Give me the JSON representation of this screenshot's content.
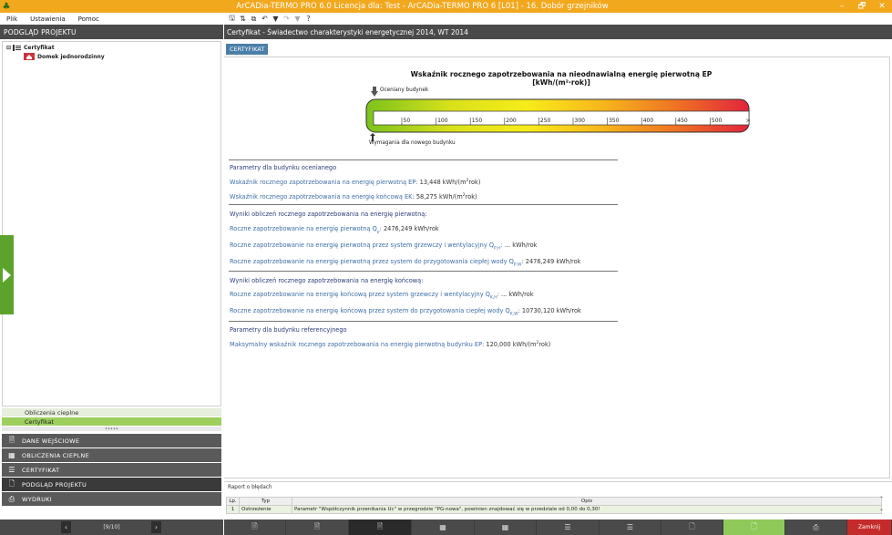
{
  "window": {
    "title": "ArCADia-TERMO PRO 6.0 Licencja dla: Test - ArCADia-TERMO PRO 6 [L01] - 16. Dobór grzejników",
    "controls": [
      "–",
      "🗗",
      "✕"
    ]
  },
  "menu": [
    "Plik",
    "Ustawienia",
    "Pomoc"
  ],
  "toolbar_icons": [
    "save-icon",
    "exchange-icon",
    "copy-icon",
    "undo-icon",
    "filter-icon",
    "redo-icon",
    "filter-dim-icon",
    "help-icon"
  ],
  "left_panel": {
    "header": "PODGLĄD PROJEKTU",
    "tree": {
      "root": "Certyfikat",
      "child": "Domek jednorodzinny"
    },
    "small_nav": [
      "Obliczenia cieplne",
      "Certyfikat"
    ],
    "big_nav": [
      {
        "label": "DANE WEJŚCIOWE",
        "icon": "data-input-icon"
      },
      {
        "label": "OBLICZENIA CIEPLNE",
        "icon": "calculations-icon"
      },
      {
        "label": "CERTYFIKAT",
        "icon": "certificate-icon"
      },
      {
        "label": "PODGLĄD PROJEKTU",
        "icon": "preview-icon"
      },
      {
        "label": "WYDRUKI",
        "icon": "printer-icon"
      }
    ],
    "pager": "[9/10]"
  },
  "right_panel": {
    "header": "Certyfikat - Świadectwo charakterystyki energetycznej 2014, WT 2014",
    "tab": "CERTYFIKAT",
    "scale": {
      "title": "Wskaźnik rocznego zapotrzebowania na nieodnawialną energię pierwotną EP [kWh/(m²·rok)]",
      "assessed_label": "Oceniany budynek",
      "required_label": "Wymagania dla nowego budynku",
      "ticks": [
        "50",
        "100",
        "150",
        "200",
        "250",
        "300",
        "350",
        "400",
        "450",
        "500",
        "> 500"
      ],
      "assessed_value": 13.448,
      "required_value": 120
    },
    "sections": {
      "s1": {
        "head": "Parametry dla budynku ocenianego",
        "r1_label": "Wskaźnik rocznego zapotrzebowania na energię pierwotną EP:",
        "r1_value": "13,448 kWh/(m",
        "r2_label": "Wskaźnik rocznego zapotrzebowania na energię końcową EK:",
        "r2_value": "58,275 kWh/(m"
      },
      "s2": {
        "head": "Wyniki obliczeń rocznego zapotrzebowania na energię pierwotną:",
        "r1_label": "Roczne zapotrzebowanie na energię pierwotną Q",
        "r1_sub": "p",
        "r1_value": "2476,249 kWh/rok",
        "r2_label": "Roczne zapotrzebowanie na energię pierwotną przez system grzewczy i wentylacyjny Q",
        "r2_sub": "P,H",
        "r2_value": "... kWh/rok",
        "r3_label": "Roczne zapotrzebowanie na energię pierwotną przez system do przygotowania ciepłej wody Q",
        "r3_sub": "P,W",
        "r3_value": "2476,249 kWh/rok"
      },
      "s3": {
        "head": "Wyniki obliczeń rocznego zapotrzebowania na energię końcową:",
        "r1_label": "Roczne zapotrzebowanie na energię końcową przez system grzewczy i wentylacyjny Q",
        "r1_sub": "K,H",
        "r1_value": "... kWh/rok",
        "r2_label": "Roczne zapotrzebowanie na energię końcową przez system do przygotowania ciepłej wody Q",
        "r2_sub": "K,W",
        "r2_value": "10730,120 kWh/rok"
      },
      "s4": {
        "head": "Parametry dla budynku referencyjnego",
        "r1_label": "Maksymalny wskaźnik rocznego zapotrzebowania na energię pierwotną budynku EP:",
        "r1_value": "120,000 kWh/(m"
      }
    }
  },
  "errors": {
    "title": "Raport o błędach",
    "columns": [
      "Lp.",
      "Typ",
      "Opis"
    ],
    "rows": [
      {
        "lp": "1",
        "type": "Ostrzeżenie",
        "desc": "Parametr \"Współczynnik przenikania Uc\" w przegrodzie \"PG-nowa\", powinien znajdować się w przedziale od 0,00 do 0,30!"
      }
    ]
  },
  "bottom_bar": {
    "close_label": "Zamknij"
  },
  "colors": {
    "title_bar": "#f2a81d",
    "accent_green": "#8fc95a",
    "close_red": "#c62b2b",
    "link_blue": "#3d6fa8"
  }
}
